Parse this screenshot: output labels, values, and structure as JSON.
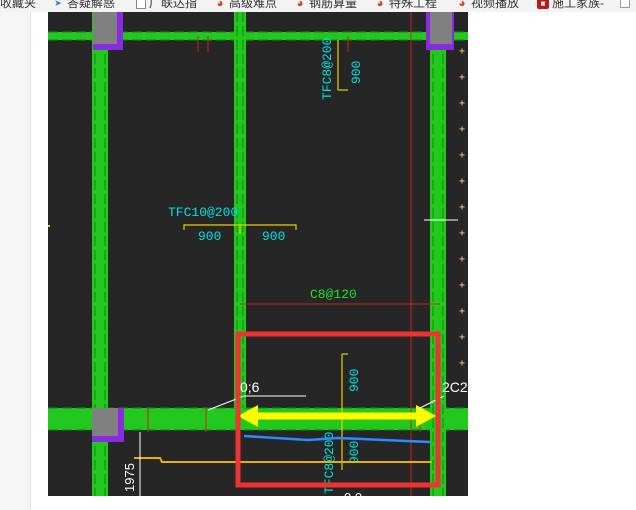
{
  "bookmarks_bar": {
    "items": [
      {
        "label": "收藏夹",
        "icon": "folder-icon"
      },
      {
        "label": "答疑解惑",
        "icon": "pin-icon"
      },
      {
        "label": "广联达指",
        "icon": "document-icon"
      },
      {
        "label": "高级难点",
        "icon": "swirl-logo-icon"
      },
      {
        "label": "钢筋算量",
        "icon": "swirl-logo-icon"
      },
      {
        "label": "特殊工程",
        "icon": "swirl-logo-icon"
      },
      {
        "label": "视频播放",
        "icon": "swirl-logo-icon"
      },
      {
        "label": "施工家族-",
        "icon": "red-badge-icon"
      },
      {
        "label": "",
        "icon": "blank-page-icon"
      }
    ]
  },
  "drawing": {
    "annotations": {
      "top_rebar": "TFC8@200",
      "top_dim": "900",
      "left_rebar": "TFC10@200",
      "left_dim_1": "900",
      "left_dim_2": "900",
      "mid_rebar": "C8@120",
      "box_dim": "900",
      "bottom_rebar": "TFC8@200",
      "bottom_dim": "900",
      "left_partial": "0;6",
      "right_partial": "2C2",
      "bottom_left_dim": "1975",
      "bottom_partial": "0 0"
    },
    "colors": {
      "background": "#262626",
      "beam_green": "#22c81e",
      "beam_edge": "#0a8a0a",
      "column_fill": "#808080",
      "column_edge": "#8a2be2",
      "text_cyan": "#00e0e0",
      "text_green": "#22e02a",
      "dim_yellow": "#e8d000",
      "arrow_yellow": "#ffff00",
      "line_blue": "#2a8cff",
      "line_orange": "#e8b000",
      "highlight_red": "#ee3333",
      "guide_red": "#d02020",
      "cross_marker": "#f0d080"
    }
  }
}
